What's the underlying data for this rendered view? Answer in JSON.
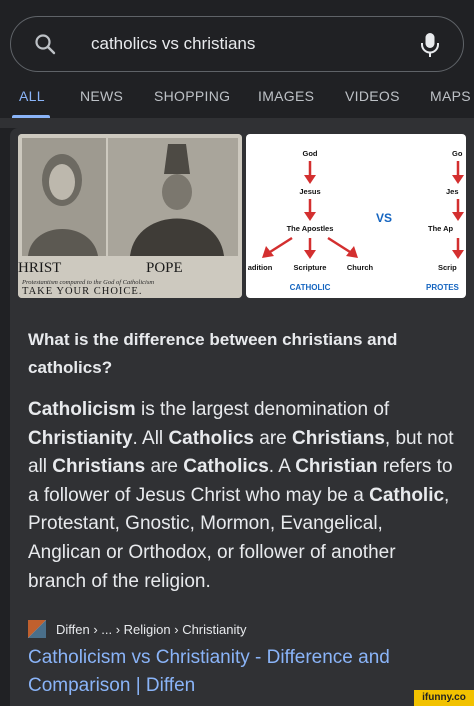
{
  "search": {
    "query": "catholics vs christians"
  },
  "tabs": [
    {
      "label": "ALL"
    },
    {
      "label": "NEWS"
    },
    {
      "label": "SHOPPING"
    },
    {
      "label": "IMAGES"
    },
    {
      "label": "VIDEOS"
    },
    {
      "label": "MAPS"
    }
  ],
  "images": {
    "left": {
      "label_left": "HRIST",
      "label_right": "POPE",
      "caption": "Protestantism compared to the God of Catholicism",
      "footer": "TAKE YOUR CHOICE."
    },
    "right": {
      "god": "God",
      "jesus": "Jesus",
      "apostles": "The Apostles",
      "vs": "VS",
      "tradition": "adition",
      "scripture": "Scripture",
      "church": "Church",
      "catholic": "CATHOLIC",
      "god2": "Go",
      "jesus2": "Jes",
      "apostles2": "The Ap",
      "scripture2": "Scrip",
      "protestant": "PROTES"
    }
  },
  "answer": {
    "title": "What is the difference between christians and catholics?",
    "segments": [
      {
        "text": "Catholicism",
        "bold": true
      },
      {
        "text": " is the largest denomination of ",
        "bold": false
      },
      {
        "text": "Christianity",
        "bold": true
      },
      {
        "text": ". All ",
        "bold": false
      },
      {
        "text": "Catholics",
        "bold": true
      },
      {
        "text": " are ",
        "bold": false
      },
      {
        "text": "Christians",
        "bold": true
      },
      {
        "text": ", but not all ",
        "bold": false
      },
      {
        "text": "Christians",
        "bold": true
      },
      {
        "text": " are ",
        "bold": false
      },
      {
        "text": "Catholics",
        "bold": true
      },
      {
        "text": ". A ",
        "bold": false
      },
      {
        "text": "Christian",
        "bold": true
      },
      {
        "text": " refers to a follower of Jesus Christ who may be a ",
        "bold": false
      },
      {
        "text": "Catholic",
        "bold": true
      },
      {
        "text": ", Protestant, Gnostic, Mormon, Evangelical, Anglican or Orthodox, or follower of another branch of the religion.",
        "bold": false
      }
    ]
  },
  "source": {
    "breadcrumb": "Diffen › ... › Religion › Christianity"
  },
  "result": {
    "link": "Catholicism vs Christianity - Difference and Comparison | Diffen"
  },
  "watermark": "ifunny.co",
  "colors": {
    "background": "#202124",
    "card": "#303134",
    "accent": "#8ab4f8",
    "diagram_arrow": "#d32f2f",
    "diagram_label": "#1565c0"
  }
}
